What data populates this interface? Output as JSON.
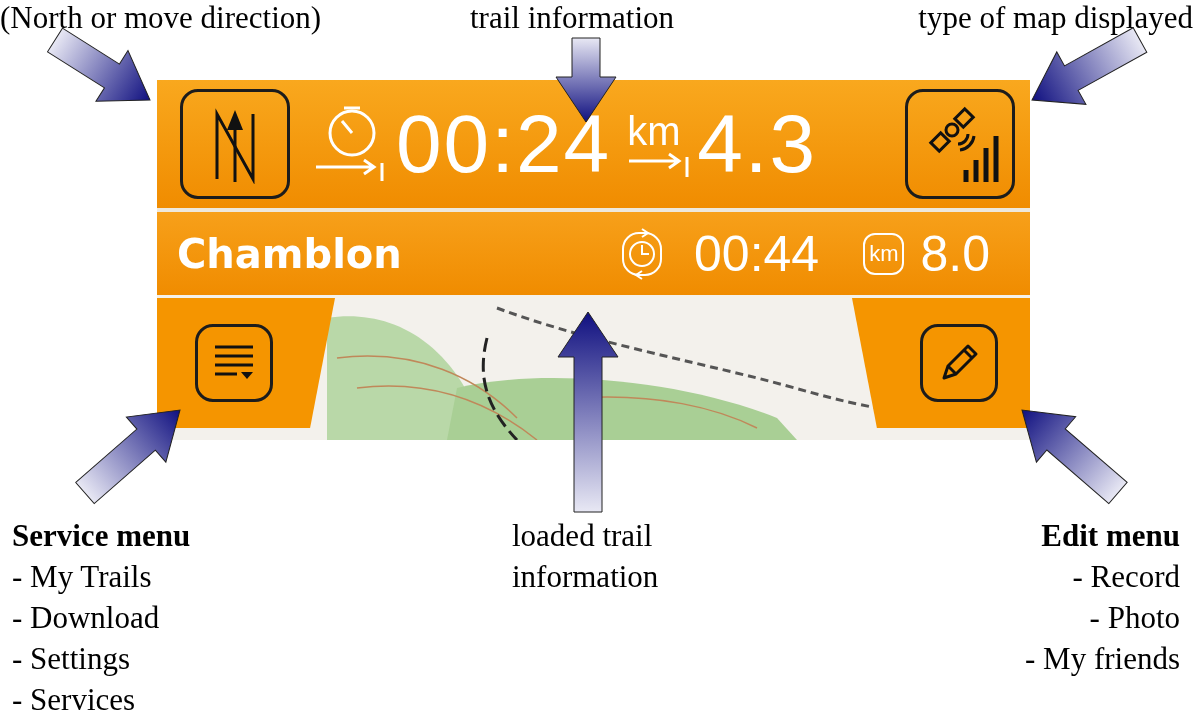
{
  "top_captions": [
    {
      "text": "(North or move direction)"
    },
    {
      "text": "trail information"
    },
    {
      "text": "type of map displayed"
    }
  ],
  "app": {
    "top_bar": {
      "elapsed_time": "00:24",
      "distance_unit": "km",
      "distance": "4.3"
    },
    "trail_bar": {
      "name": "Chamblon",
      "total_time": "00:44",
      "total_distance_unit": "km",
      "total_distance": "8.0"
    }
  },
  "notes": [
    {
      "kind": "left",
      "title": "Service menu",
      "lines": [
        "- My Trails",
        "- Download",
        "- Settings",
        "- Services"
      ]
    },
    {
      "kind": "center",
      "lines": [
        "loaded trail",
        "information"
      ]
    },
    {
      "kind": "right",
      "title": "Edit menu",
      "lines": [
        "- Record",
        "- Photo",
        "- My friends"
      ]
    }
  ]
}
